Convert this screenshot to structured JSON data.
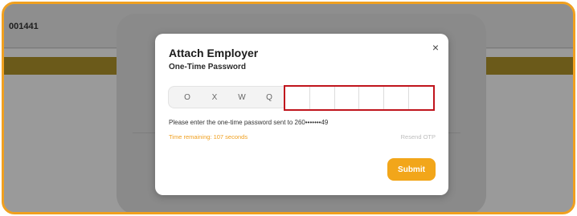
{
  "background": {
    "record_id": "001441"
  },
  "modal": {
    "title": "Attach Employer",
    "subtitle": "One-Time Password",
    "close_label": "×",
    "otp_prefix": [
      "O",
      "X",
      "W",
      "Q"
    ],
    "otp_separator": "•",
    "otp_cells": [
      "",
      "",
      "",
      "",
      "",
      ""
    ],
    "prompt": "Please enter the one-time password sent to 260•••••••49",
    "timer": "Time remaining: 107 seconds",
    "resend_label": "Resend OTP",
    "submit_label": "Submit"
  },
  "colors": {
    "accent": "#f2a61a",
    "highlight_border": "#c0151d",
    "frame_border": "#f0a020"
  }
}
